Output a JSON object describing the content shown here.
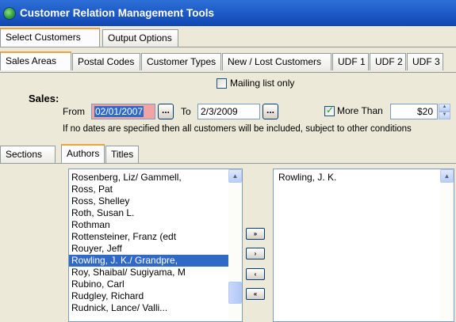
{
  "window": {
    "title": "Customer Relation Management Tools"
  },
  "top_tabs": [
    "Select Customers",
    "Output Options"
  ],
  "filter_tabs": [
    "Sales Areas",
    "Postal Codes",
    "Customer Types",
    "New / Lost Customers",
    "UDF 1",
    "UDF 2",
    "UDF 3"
  ],
  "mailing": {
    "label": "Mailing list only",
    "checked": false
  },
  "sales": {
    "section_label": "Sales:",
    "from_label": "From",
    "from_value": "02/01/2007",
    "to_label": "To",
    "to_value": "2/3/2009",
    "picker_label": "...",
    "more_than_label": "More Than",
    "more_than_checked": true,
    "amount": "$20",
    "note": "If no dates are specified then all customers will be included, subject to other conditions"
  },
  "category_tabs": [
    "Sections",
    "Authors",
    "Titles"
  ],
  "authors": {
    "available": [
      "Rosenberg, Liz/ Gammell,",
      "Ross, Pat",
      "Ross, Shelley",
      "Roth, Susan L.",
      "Rothman",
      "Rottensteiner, Franz (edt",
      "Rouyer, Jeff",
      "Rowling, J. K./ Grandpre,",
      "Roy, Shaibal/ Sugiyama, M",
      "Rubino, Carl",
      "Rudgley, Richard",
      "Rudnick, Lance/ Valli..."
    ],
    "selected_index": 7,
    "chosen": [
      "Rowling, J. K."
    ]
  },
  "move_buttons": {
    "add_all": "»",
    "add": "›",
    "remove": "‹",
    "remove_all": "«"
  }
}
